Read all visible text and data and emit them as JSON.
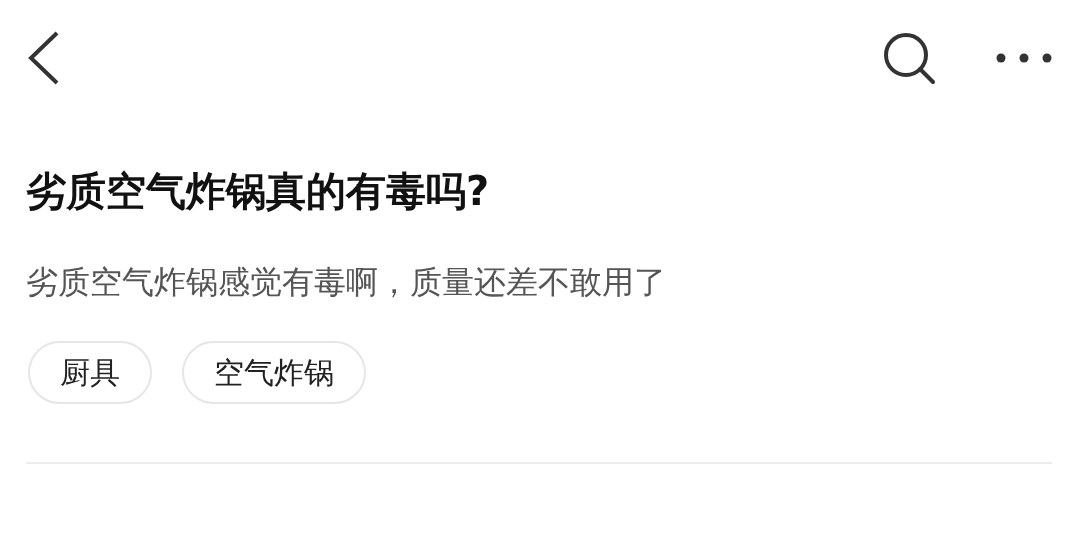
{
  "question": {
    "title": "劣质空气炸锅真的有毒吗?",
    "description": "劣质空气炸锅感觉有毒啊，质量还差不敢用了"
  },
  "tags": [
    "厨具",
    "空气炸锅"
  ]
}
